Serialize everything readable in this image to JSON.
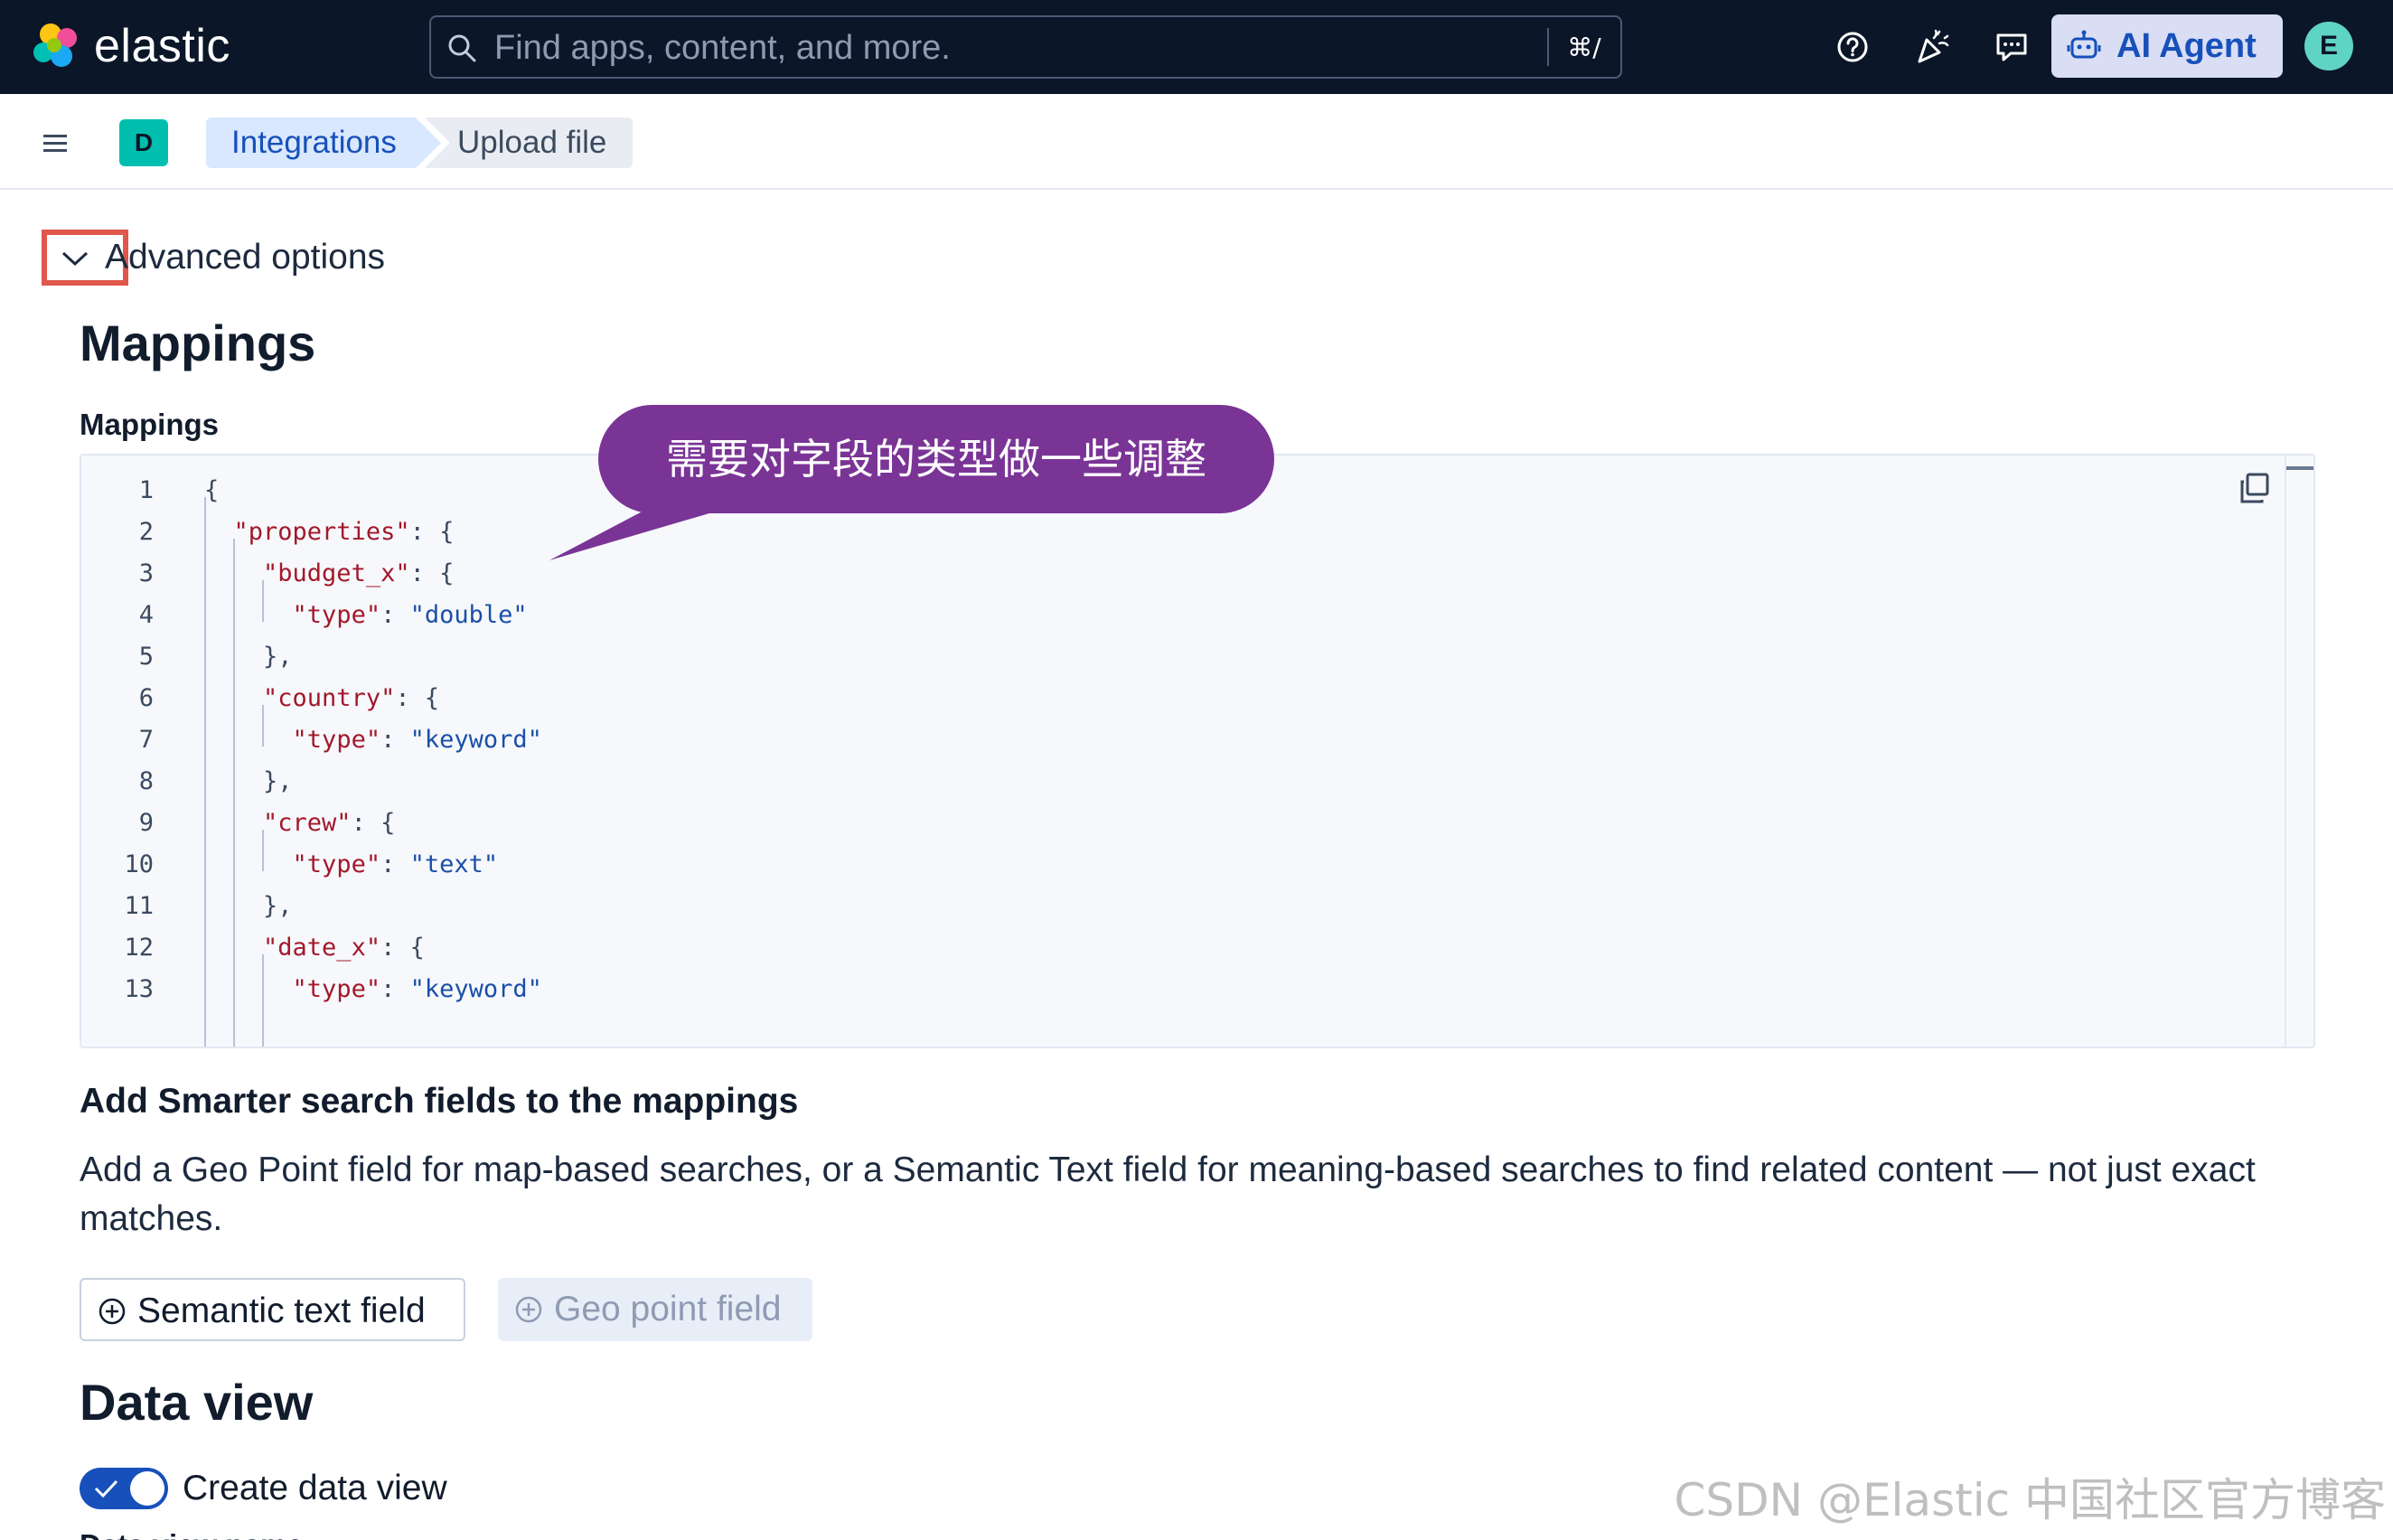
{
  "header": {
    "brand": "elastic",
    "search_placeholder": "Find apps, content, and more.",
    "search_shortcut": "⌘/",
    "ai_agent_label": "AI Agent",
    "avatar_initial": "E"
  },
  "subheader": {
    "space_initial": "D",
    "breadcrumbs": [
      "Integrations",
      "Upload file"
    ]
  },
  "advanced": {
    "label": "Advanced options"
  },
  "mappings": {
    "title": "Mappings",
    "editor_label": "Mappings",
    "code_lines": [
      {
        "n": "1",
        "indent": "",
        "key": "",
        "sep": "",
        "val": "",
        "tail": "{"
      },
      {
        "n": "2",
        "indent": "  ",
        "key": "\"properties\"",
        "sep": ": ",
        "val": "",
        "tail": "{"
      },
      {
        "n": "3",
        "indent": "    ",
        "key": "\"budget_x\"",
        "sep": ": ",
        "val": "",
        "tail": "{"
      },
      {
        "n": "4",
        "indent": "      ",
        "key": "\"type\"",
        "sep": ": ",
        "val": "\"double\"",
        "tail": ""
      },
      {
        "n": "5",
        "indent": "    ",
        "key": "",
        "sep": "",
        "val": "",
        "tail": "},"
      },
      {
        "n": "6",
        "indent": "    ",
        "key": "\"country\"",
        "sep": ": ",
        "val": "",
        "tail": "{"
      },
      {
        "n": "7",
        "indent": "      ",
        "key": "\"type\"",
        "sep": ": ",
        "val": "\"keyword\"",
        "tail": ""
      },
      {
        "n": "8",
        "indent": "    ",
        "key": "",
        "sep": "",
        "val": "",
        "tail": "},"
      },
      {
        "n": "9",
        "indent": "    ",
        "key": "\"crew\"",
        "sep": ": ",
        "val": "",
        "tail": "{"
      },
      {
        "n": "10",
        "indent": "      ",
        "key": "\"type\"",
        "sep": ": ",
        "val": "\"text\"",
        "tail": ""
      },
      {
        "n": "11",
        "indent": "    ",
        "key": "",
        "sep": "",
        "val": "",
        "tail": "},"
      },
      {
        "n": "12",
        "indent": "    ",
        "key": "\"date_x\"",
        "sep": ": ",
        "val": "",
        "tail": "{"
      },
      {
        "n": "13",
        "indent": "      ",
        "key": "\"type\"",
        "sep": ": ",
        "val": "\"keyword\"",
        "tail": ""
      }
    ]
  },
  "callout": {
    "text": "需要对字段的类型做一些调整",
    "color": "#7a3496"
  },
  "smarter_search": {
    "title": "Add Smarter search fields to the mappings",
    "description": "Add a Geo Point field for map-based searches, or a Semantic Text field for meaning-based searches to find related content — not just exact matches.",
    "semantic_button": "Semantic text field",
    "geo_button": "Geo point field"
  },
  "data_view": {
    "title": "Data view",
    "toggle_label": "Create data view",
    "toggle_on": true,
    "name_label": "Data view name"
  },
  "watermark": "CSDN @Elastic 中国社区官方博客",
  "colors": {
    "header_bg": "#0b1628",
    "accent": "#1750ba",
    "highlight_box": "#e0574b"
  },
  "icons": [
    "elastic-logo-icon",
    "search-icon",
    "help-icon",
    "party-icon",
    "feedback-icon",
    "robot-icon",
    "menu-icon",
    "chevron-down-icon",
    "copy-icon",
    "plus-circle-icon",
    "check-icon"
  ]
}
